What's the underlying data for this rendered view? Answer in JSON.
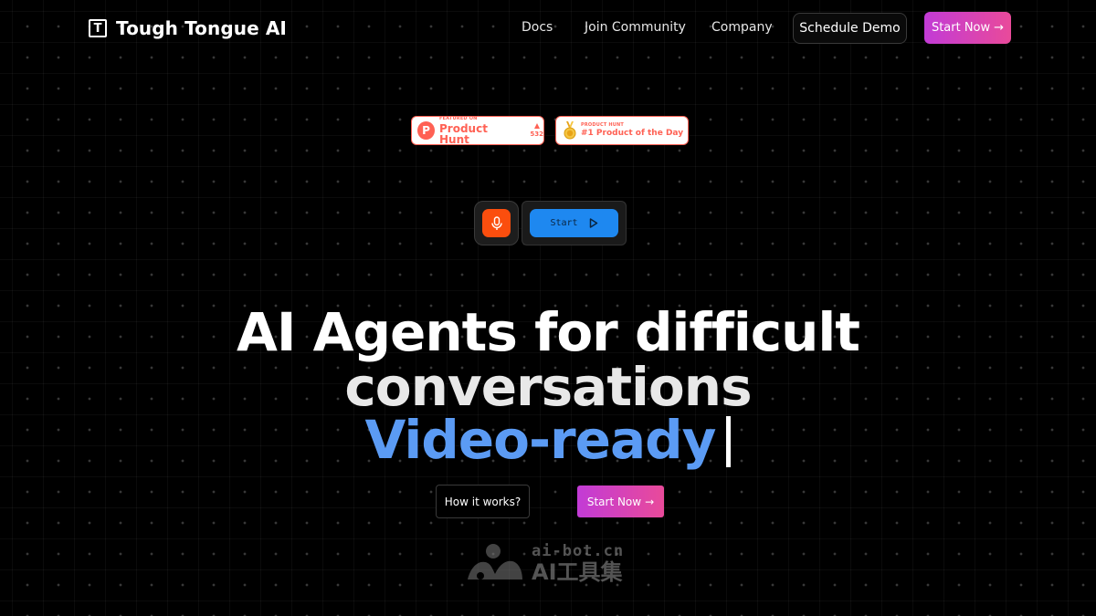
{
  "header": {
    "logo_mark": "T",
    "logo_text": "Tough Tongue AI",
    "nav": {
      "docs": "Docs",
      "join_community": "Join Community",
      "company": "Company"
    },
    "schedule_demo": "Schedule Demo",
    "start_now": "Start Now",
    "arrow": "→"
  },
  "badges": {
    "product_hunt": {
      "letter": "P",
      "small": "FEATURED ON",
      "big": "Product Hunt",
      "upvotes": "532"
    },
    "product_of_day": {
      "small": "PRODUCT HUNT",
      "big": "#1 Product of the Day"
    }
  },
  "widget": {
    "start_label": "Start"
  },
  "hero": {
    "line1": "AI Agents for difficult",
    "line2": "conversations",
    "line3": "Video-ready"
  },
  "cta": {
    "how_it_works": "How it works?",
    "start_now": "Start Now",
    "arrow": "→"
  },
  "watermark": {
    "top": "ai-bot.cn",
    "bottom": "AI工具集"
  },
  "colors": {
    "accent_gradient_start": "#c23bd6",
    "accent_gradient_end": "#e94a9a",
    "product_hunt": "#ff6154",
    "mic": "#fb4e0e",
    "start_button": "#1e88f0",
    "highlight_text": "#5b9bf4"
  }
}
